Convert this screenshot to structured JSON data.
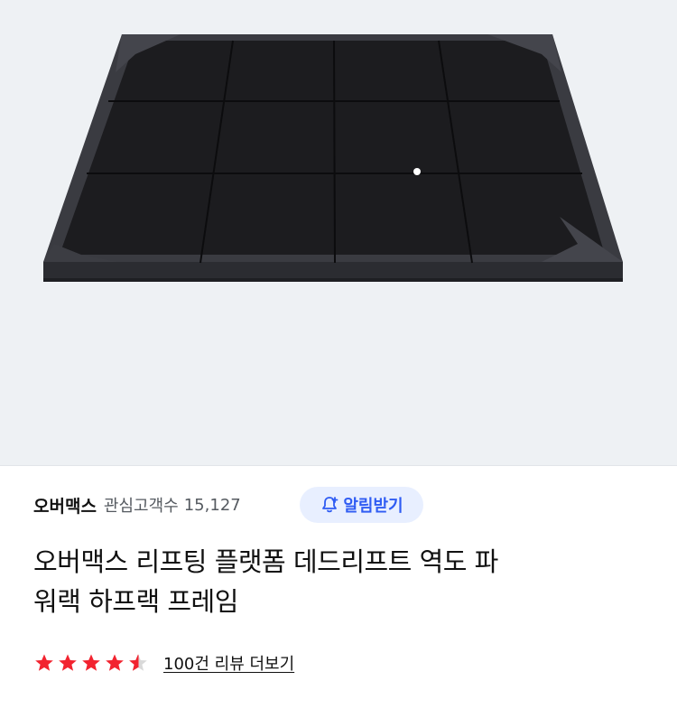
{
  "product": {
    "image_alt_icon": "lifting-platform-image",
    "seller": {
      "name": "오버맥스",
      "followers_label": "관심고객수",
      "followers_count": "15,127"
    },
    "notify_button": {
      "label": "알림받기",
      "icon": "bell-plus-icon",
      "bg": "#e8efff",
      "color": "#2f5cf3"
    },
    "title_line1": "오버맥스 리프팅 플랫폼 데드리프트 역도 파",
    "title_line2": "워랙 하프랙 프레임",
    "rating": {
      "value": 4.5,
      "max": 5,
      "star_color": "#f2232f",
      "review_link": "100건 리뷰 더보기"
    }
  }
}
